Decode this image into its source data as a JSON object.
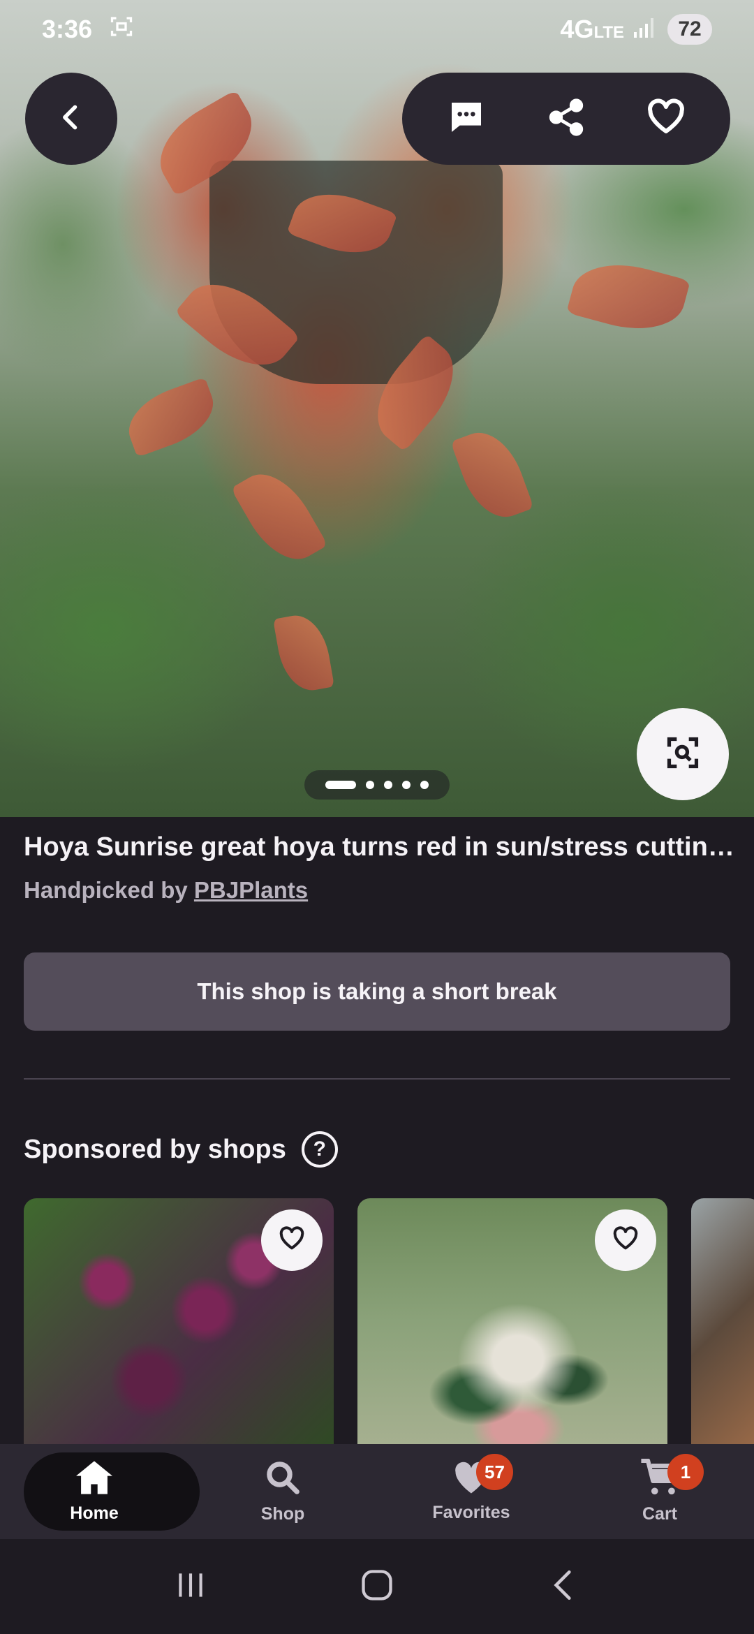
{
  "status_bar": {
    "time": "3:36",
    "network": "4G",
    "lte": "LTE",
    "battery": "72"
  },
  "hero": {
    "image_alt": "Hoya Sunrise plant with red-orange leaves hanging in greenhouse",
    "carousel": {
      "total": 5,
      "active": 1
    }
  },
  "product": {
    "title": "Hoya Sunrise great hoya turns red in sun/stress cuttings...",
    "handpicked_prefix": "Handpicked by ",
    "shop_name": "PBJPlants"
  },
  "banner": {
    "text": "This shop is taking a short break"
  },
  "sponsored": {
    "heading": "Sponsored by shops",
    "help": "?"
  },
  "bottom_nav": {
    "items": [
      {
        "label": "Home",
        "icon": "home-icon",
        "active": true
      },
      {
        "label": "Shop",
        "icon": "search-icon",
        "active": false
      },
      {
        "label": "Favorites",
        "icon": "heart-icon",
        "active": false,
        "badge": "57"
      },
      {
        "label": "Cart",
        "icon": "cart-icon",
        "active": false,
        "badge": "1"
      }
    ]
  },
  "colors": {
    "background": "#1e1b22",
    "banner": "#544d5a",
    "badge": "#d1401f",
    "nav_bar": "#2c2832"
  }
}
